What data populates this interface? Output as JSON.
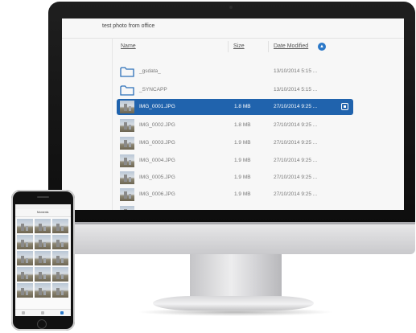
{
  "window": {
    "title": "test photo from office"
  },
  "columns": {
    "name": "Name",
    "size": "Size",
    "date_modified": "Date Modified"
  },
  "rows": [
    {
      "name": "_gsdata_",
      "size": "",
      "date": "13/10/2014 5:15 ...",
      "type": "folder",
      "selected": false
    },
    {
      "name": "_SYNCAPP",
      "size": "",
      "date": "13/10/2014 5:15 ...",
      "type": "folder",
      "selected": false
    },
    {
      "name": "IMG_0001.JPG",
      "size": "1.8 MB",
      "date": "27/10/2014 9:25 ...",
      "type": "photo",
      "selected": true
    },
    {
      "name": "IMG_0002.JPG",
      "size": "1.8 MB",
      "date": "27/10/2014 9:25 ...",
      "type": "photo",
      "selected": false
    },
    {
      "name": "IMG_0003.JPG",
      "size": "1.9 MB",
      "date": "27/10/2014 9:25 ...",
      "type": "photo",
      "selected": false
    },
    {
      "name": "IMG_0004.JPG",
      "size": "1.9 MB",
      "date": "27/10/2014 9:25 ...",
      "type": "photo",
      "selected": false
    },
    {
      "name": "IMG_0005.JPG",
      "size": "1.9 MB",
      "date": "27/10/2014 9:25 ...",
      "type": "photo",
      "selected": false
    },
    {
      "name": "IMG_0006.JPG",
      "size": "1.9 MB",
      "date": "27/10/2014 9:25 ...",
      "type": "photo",
      "selected": false
    }
  ],
  "icons": {
    "folder": "folder-icon",
    "photo": "photo-thumbnail-icon",
    "sort": "sort-ascending-icon",
    "row_menu": "row-menu-icon"
  },
  "colors": {
    "selection": "#2063ad",
    "accent": "#2b78c8"
  },
  "phone": {
    "nav_title": "Moments"
  }
}
